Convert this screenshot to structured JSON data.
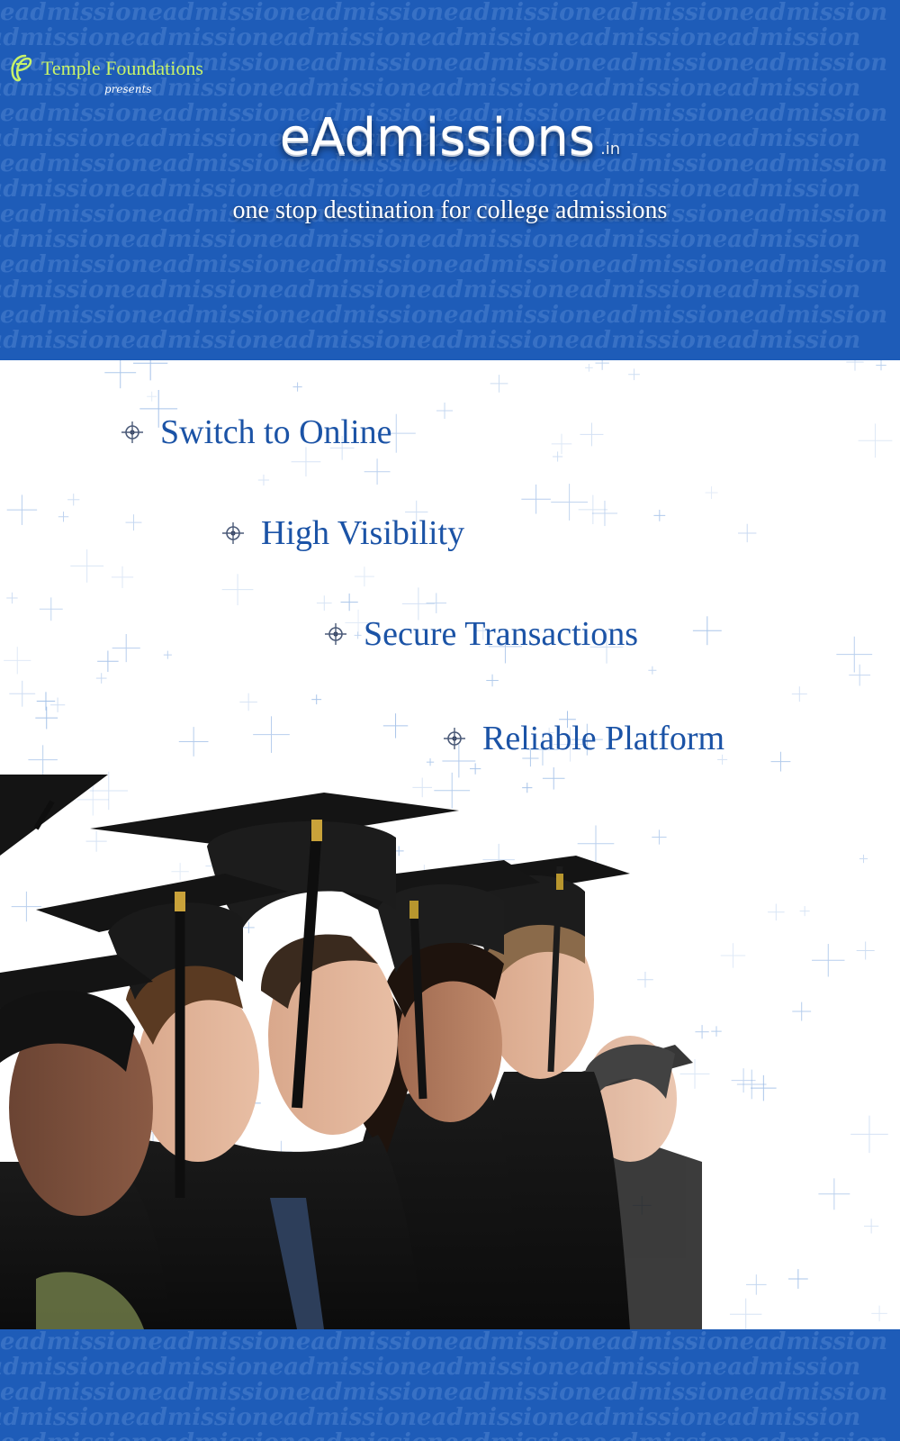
{
  "header": {
    "logo_text": "Temple Foundations",
    "presents": "presents",
    "brand_name": "eAdmissions",
    "brand_tld": ".in",
    "tagline": "one stop destination for college admissions",
    "pattern_text": "eadmissioneadmissioneadmissioneadmissioneadmissioneadmission"
  },
  "features": [
    {
      "label": "Switch to Online",
      "icon": "crosshair-bullet-icon"
    },
    {
      "label": "High Visibility",
      "icon": "crosshair-bullet-icon"
    },
    {
      "label": "Secure Transactions",
      "icon": "crosshair-bullet-icon"
    },
    {
      "label": "Reliable Platform",
      "icon": "crosshair-bullet-icon"
    }
  ],
  "colors": {
    "header_blue": "#1e5cb8",
    "pattern_blue": "#3d75c8",
    "feature_text": "#1b53a6",
    "logo_green": "#c6f26a"
  }
}
